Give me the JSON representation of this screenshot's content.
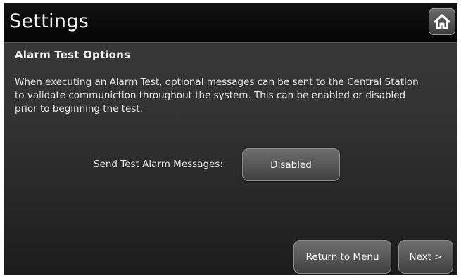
{
  "header": {
    "title": "Settings",
    "home_icon": "home-icon"
  },
  "section": {
    "title": "Alarm Test Options",
    "description": "When executing an Alarm Test, optional messages can be sent to the Central Station to validate communiction throughout the system.  This can be enabled or disabled prior to beginning the test."
  },
  "setting": {
    "label": "Send Test Alarm Messages:",
    "value": "Disabled"
  },
  "footer": {
    "return_label": "Return to Menu",
    "next_label": "Next >"
  }
}
